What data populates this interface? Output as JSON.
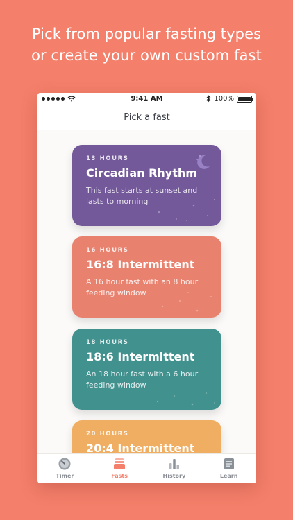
{
  "headline": {
    "line1": "Pick from popular fasting types",
    "line2": "or create your own custom fast"
  },
  "status_bar": {
    "time": "9:41 AM",
    "battery": "100%"
  },
  "nav": {
    "title": "Pick a fast"
  },
  "cards": [
    {
      "hours": "13 HOURS",
      "title": "Circadian Rhythm",
      "description": "This fast starts at sunset and lasts to morning",
      "color": "#73599A"
    },
    {
      "hours": "16 HOURS",
      "title": "16:8 Intermittent",
      "description": "A 16 hour fast with an 8 hour feeding window",
      "color": "#E8826F"
    },
    {
      "hours": "18 HOURS",
      "title": "18:6 Intermittent",
      "description": "An 18 hour fast with a 6 hour feeding window",
      "color": "#41918F"
    },
    {
      "hours": "20 HOURS",
      "title": "20:4 Intermittent",
      "description": "",
      "color": "#EFAE62"
    }
  ],
  "tabs": [
    {
      "label": "Timer",
      "icon": "timer-icon",
      "active": false
    },
    {
      "label": "Fasts",
      "icon": "fasts-icon",
      "active": true
    },
    {
      "label": "History",
      "icon": "history-icon",
      "active": false
    },
    {
      "label": "Learn",
      "icon": "learn-icon",
      "active": false
    }
  ],
  "colors": {
    "background": "#F47F6A",
    "accent": "#F47F6A",
    "tab_inactive": "#8A8E94"
  }
}
